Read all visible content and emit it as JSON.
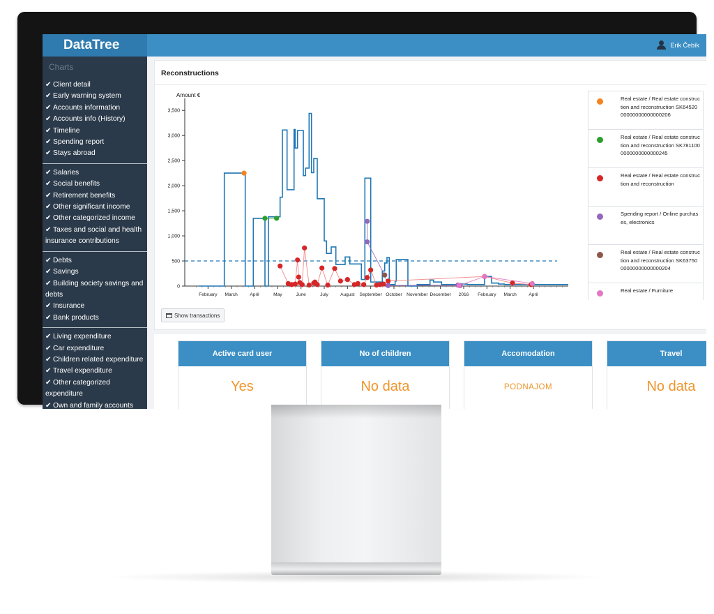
{
  "app": {
    "name": "DataTree",
    "user": "Erik Čebík"
  },
  "sidebar": {
    "title": "Charts",
    "groups": [
      [
        "Client detail",
        "Early warning system",
        "Accounts information",
        "Accounts info (History)",
        "Timeline",
        "Spending report",
        "Stays abroad"
      ],
      [
        "Salaries",
        "Social benefits",
        "Retirement benefits",
        "Other significant income",
        "Other categorized income",
        "Taxes and social and health insurance contributions"
      ],
      [
        "Debts",
        "Savings",
        "Building society savings and debts",
        "Insurance",
        "Bank products"
      ],
      [
        "Living expenditure",
        "Car expenditure",
        "Children related expenditure",
        "Travel expenditure",
        "Other categorized expenditure",
        "Own and family accounts"
      ]
    ]
  },
  "panel": {
    "title": "Reconstructions",
    "button_label": "Show transactions",
    "button_icon": "calendar-icon"
  },
  "legend": [
    {
      "color": "#f5841f",
      "text": "Real estate / Real estate construction and reconstruction SK6452000000000000000206"
    },
    {
      "color": "#2ca02c",
      "text": "Real estate / Real estate construction and reconstruction SK7811000000000000000245"
    },
    {
      "color": "#d62728",
      "text": "Real estate / Real estate construction and reconstruction"
    },
    {
      "color": "#9467bd",
      "text": "Spending report / Online purchases, electronics"
    },
    {
      "color": "#8c564b",
      "text": "Real estate / Real estate construction and reconstruction SK6375000000000000000204"
    },
    {
      "color": "#e377c2",
      "text": "Real estate / Furniture"
    }
  ],
  "cards": [
    {
      "title": "Active card user",
      "value": "Yes"
    },
    {
      "title": "No of children",
      "value": "No data"
    },
    {
      "title": "Accomodation",
      "value": "PODNAJOM"
    },
    {
      "title": "Travel",
      "value": "No data"
    }
  ],
  "chart_data": {
    "type": "line",
    "ylabel": "Amount €",
    "ylim": [
      0,
      3600
    ],
    "y_ticks": [
      "0",
      "500",
      "1,000",
      "1,500",
      "2,000",
      "2,500",
      "3,000",
      "3,500"
    ],
    "x_ticks": [
      "February",
      "March",
      "April",
      "May",
      "June",
      "July",
      "August",
      "September",
      "October",
      "November",
      "December",
      "2016",
      "February",
      "March",
      "April"
    ],
    "threshold": 500,
    "balance_series": {
      "name": "balance",
      "color": "#1f77b4",
      "x": [
        0.6,
        1.7,
        1.7,
        2.6,
        2.6,
        2.95,
        2.95,
        3.45,
        3.45,
        3.6,
        3.6,
        4.1,
        4.1,
        4.2,
        4.2,
        4.4,
        4.4,
        4.7,
        4.7,
        4.75,
        4.75,
        4.85,
        4.85,
        5.1,
        5.1,
        5.2,
        5.2,
        5.35,
        5.35,
        5.45,
        5.45,
        5.55,
        5.55,
        5.7,
        5.7,
        6.0,
        6.0,
        6.1,
        6.1,
        6.3,
        6.3,
        6.5,
        6.5,
        6.9,
        6.9,
        7.1,
        7.1,
        7.6,
        7.6,
        7.75,
        7.75,
        8.0,
        8.0,
        8.5,
        8.5,
        8.6,
        8.6,
        8.7,
        8.7,
        8.8,
        8.8,
        9.05,
        9.05,
        9.1,
        9.1,
        9.6,
        9.6,
        10.0,
        10.0,
        10.55,
        10.55,
        10.7,
        10.7,
        11.05,
        11.05,
        11.7,
        11.7,
        12.15,
        12.15,
        12.9,
        12.9,
        13.2,
        13.2,
        13.5,
        13.5,
        13.75,
        13.75,
        14.5,
        14.5,
        16.5
      ],
      "y": [
        0,
        0,
        2250,
        2250,
        0,
        0,
        1350,
        1350,
        0,
        0,
        1380,
        1380,
        1770,
        1770,
        3110,
        3110,
        1920,
        1920,
        3120,
        3120,
        2750,
        2750,
        3100,
        3100,
        2200,
        2200,
        2350,
        2350,
        3440,
        3440,
        2260,
        2260,
        2540,
        2540,
        1740,
        1740,
        900,
        900,
        650,
        650,
        780,
        780,
        430,
        430,
        580,
        580,
        440,
        440,
        130,
        130,
        2150,
        2150,
        80,
        80,
        300,
        300,
        460,
        460,
        570,
        570,
        30,
        30,
        100,
        100,
        530,
        530,
        0,
        0,
        30,
        30,
        120,
        120,
        80,
        80,
        30,
        30,
        40,
        40,
        30,
        30,
        190,
        190,
        60,
        60,
        40,
        40,
        30,
        30,
        30,
        30,
        0,
        0
      ]
    },
    "points": [
      {
        "color": "#f5841f",
        "line_color": "#f5841f",
        "x": [
          2.55
        ],
        "y": [
          2250
        ]
      },
      {
        "color": "#2ca02c",
        "line_color": "#2ca02c",
        "x": [
          3.45,
          3.95
        ],
        "y": [
          1350,
          1350
        ]
      },
      {
        "color": "#d62728",
        "line_color": "#f08080",
        "x": [
          4.1,
          4.45,
          4.6,
          4.75,
          4.85,
          4.9,
          4.95,
          5.05,
          5.15,
          5.35,
          5.55,
          5.6,
          5.7,
          5.9,
          6.15,
          6.45,
          6.7,
          7.0,
          7.3,
          7.45,
          7.7,
          7.85,
          8.0,
          8.25,
          8.4,
          8.55,
          8.75,
          12.9,
          14.1,
          14.9
        ],
        "y": [
          400,
          50,
          30,
          40,
          520,
          180,
          70,
          30,
          760,
          20,
          60,
          80,
          30,
          360,
          20,
          350,
          100,
          130,
          30,
          50,
          30,
          170,
          320,
          20,
          30,
          40,
          100,
          190,
          60,
          30
        ]
      },
      {
        "color": "#9467bd",
        "line_color": "#9467bd",
        "x": [
          7.85,
          7.85,
          8.6,
          8.75,
          11.75,
          11.85
        ],
        "y": [
          1290,
          880,
          220,
          10,
          20,
          10
        ]
      },
      {
        "color": "#8c564b",
        "line_color": "#8c564b",
        "x": [
          8.6
        ],
        "y": [
          220
        ]
      },
      {
        "color": "#e377c2",
        "line_color": "#e377c2",
        "x": [
          11.8,
          12.9,
          14.95
        ],
        "y": [
          10,
          190,
          50
        ]
      }
    ]
  }
}
